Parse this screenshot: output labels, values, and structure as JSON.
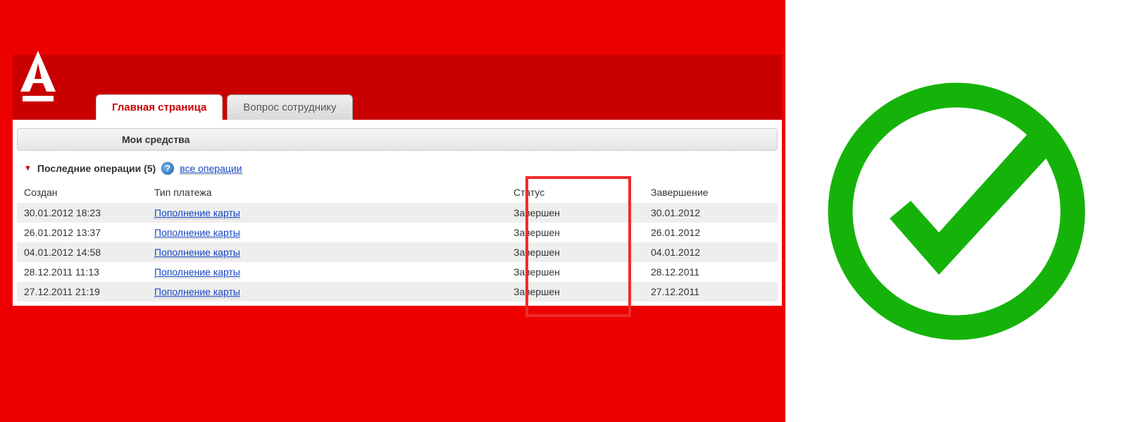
{
  "tabs": {
    "main": "Главная страница",
    "ask": "Вопрос сотруднику"
  },
  "section_title": "Мои средства",
  "ops": {
    "title": "Последние операции (5)",
    "all_link": "все операции",
    "columns": {
      "created": "Создан",
      "type": "Тип платежа",
      "status": "Статус",
      "done": "Завершение"
    },
    "rows": [
      {
        "created": "30.01.2012 18:23",
        "type": "Пополнение карты",
        "status": "Завершен",
        "done": "30.01.2012"
      },
      {
        "created": "26.01.2012 13:37",
        "type": "Пополнение карты",
        "status": "Завершен",
        "done": "26.01.2012"
      },
      {
        "created": "04.01.2012 14:58",
        "type": "Пополнение карты",
        "status": "Завершен",
        "done": "04.01.2012"
      },
      {
        "created": "28.12.2011 11:13",
        "type": "Пополнение карты",
        "status": "Завершен",
        "done": "28.12.2011"
      },
      {
        "created": "27.12.2011 21:19",
        "type": "Пополнение карты",
        "status": "Завершен",
        "done": "27.12.2011"
      }
    ]
  }
}
